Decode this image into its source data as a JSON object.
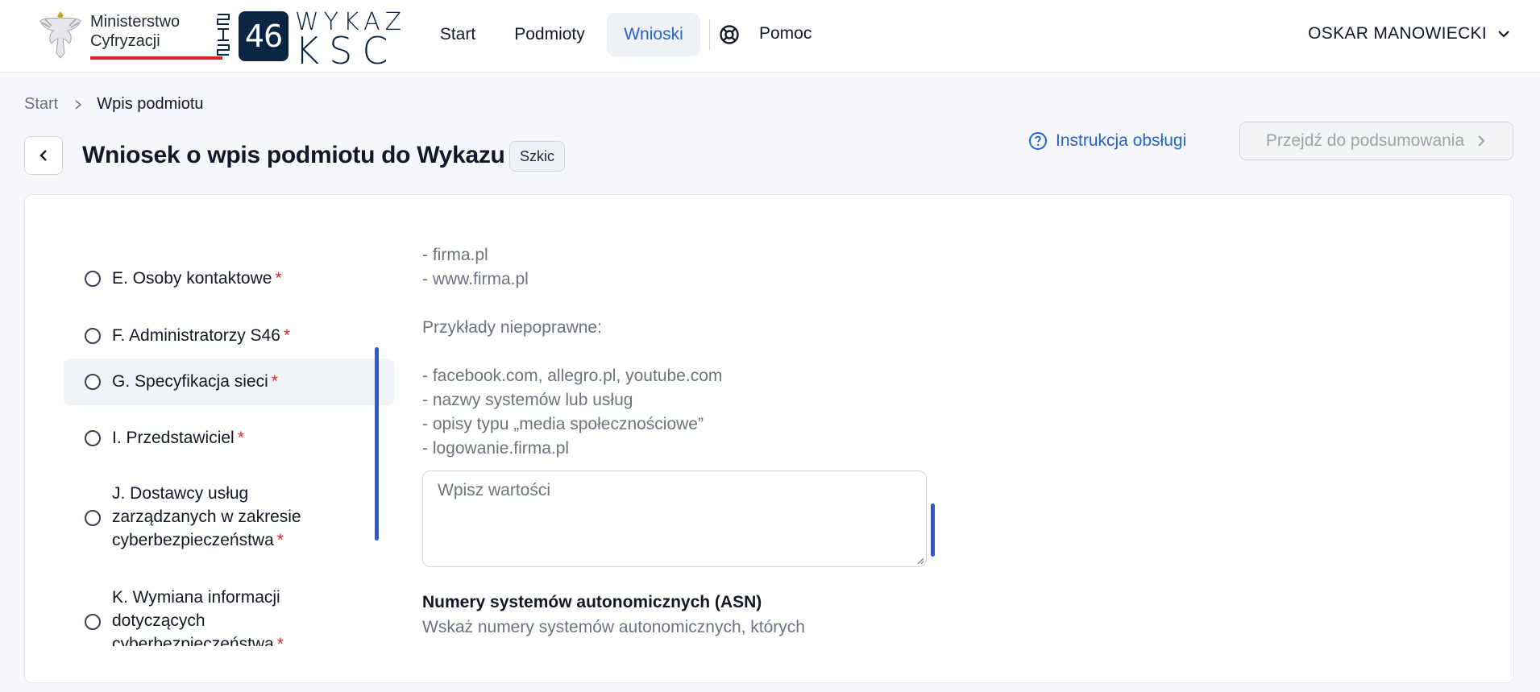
{
  "header": {
    "ministry_logo": {
      "line1": "Ministerstwo",
      "line2": "Cyfryzacji"
    },
    "ksc_logo": {
      "badge": "46",
      "top": "WYKAZ",
      "bottom": "KSC",
      "vertical": "SKS"
    },
    "nav": {
      "start": "Start",
      "podmioty": "Podmioty",
      "wnioski": "Wnioski",
      "pomoc": "Pomoc"
    },
    "user": "OSKAR MANOWIECKI"
  },
  "breadcrumb": {
    "start": "Start",
    "current": "Wpis podmiotu"
  },
  "title": "Wniosek o wpis podmiotu do Wykazu",
  "status": "Szkic",
  "actions": {
    "instruction": "Instrukcja obsługi",
    "summary": "Przejdź do podsumowania"
  },
  "steps": [
    {
      "label": "E. Osoby kontaktowe",
      "required": "*"
    },
    {
      "label": "F. Administratorzy S46",
      "required": "*"
    },
    {
      "label": "G. Specyfikacja sieci",
      "required": "*"
    },
    {
      "label": "I. Przedstawiciel",
      "required": "*"
    },
    {
      "line1": "J. Dostawcy usług",
      "line2": "zarządzanych w zakresie",
      "line3": "cyberbezpieczeństwa",
      "required": "*"
    },
    {
      "line1": "K. Wymiana informacji",
      "line2": "dotyczących",
      "line3": "cyberbezpieczeństwa",
      "required": "*"
    }
  ],
  "content": {
    "help_lines": [
      "- firma.pl",
      "- www.firma.pl",
      "Przykłady niepoprawne:",
      "- facebook.com, allegro.pl, youtube.com",
      "- nazwy systemów lub usług",
      "- opisy typu „media społecznościowe”",
      "- logowanie.firma.pl"
    ],
    "textarea_placeholder": "Wpisz wartości",
    "asn_label": "Numery systemów autonomicznych (ASN)",
    "asn_help": "Wskaż numery systemów autonomicznych, których"
  },
  "colors": {
    "accent": "#2563c9",
    "required": "#dc2626",
    "brand_dark": "#0b2545",
    "scrollbar": "#2f56d9"
  }
}
